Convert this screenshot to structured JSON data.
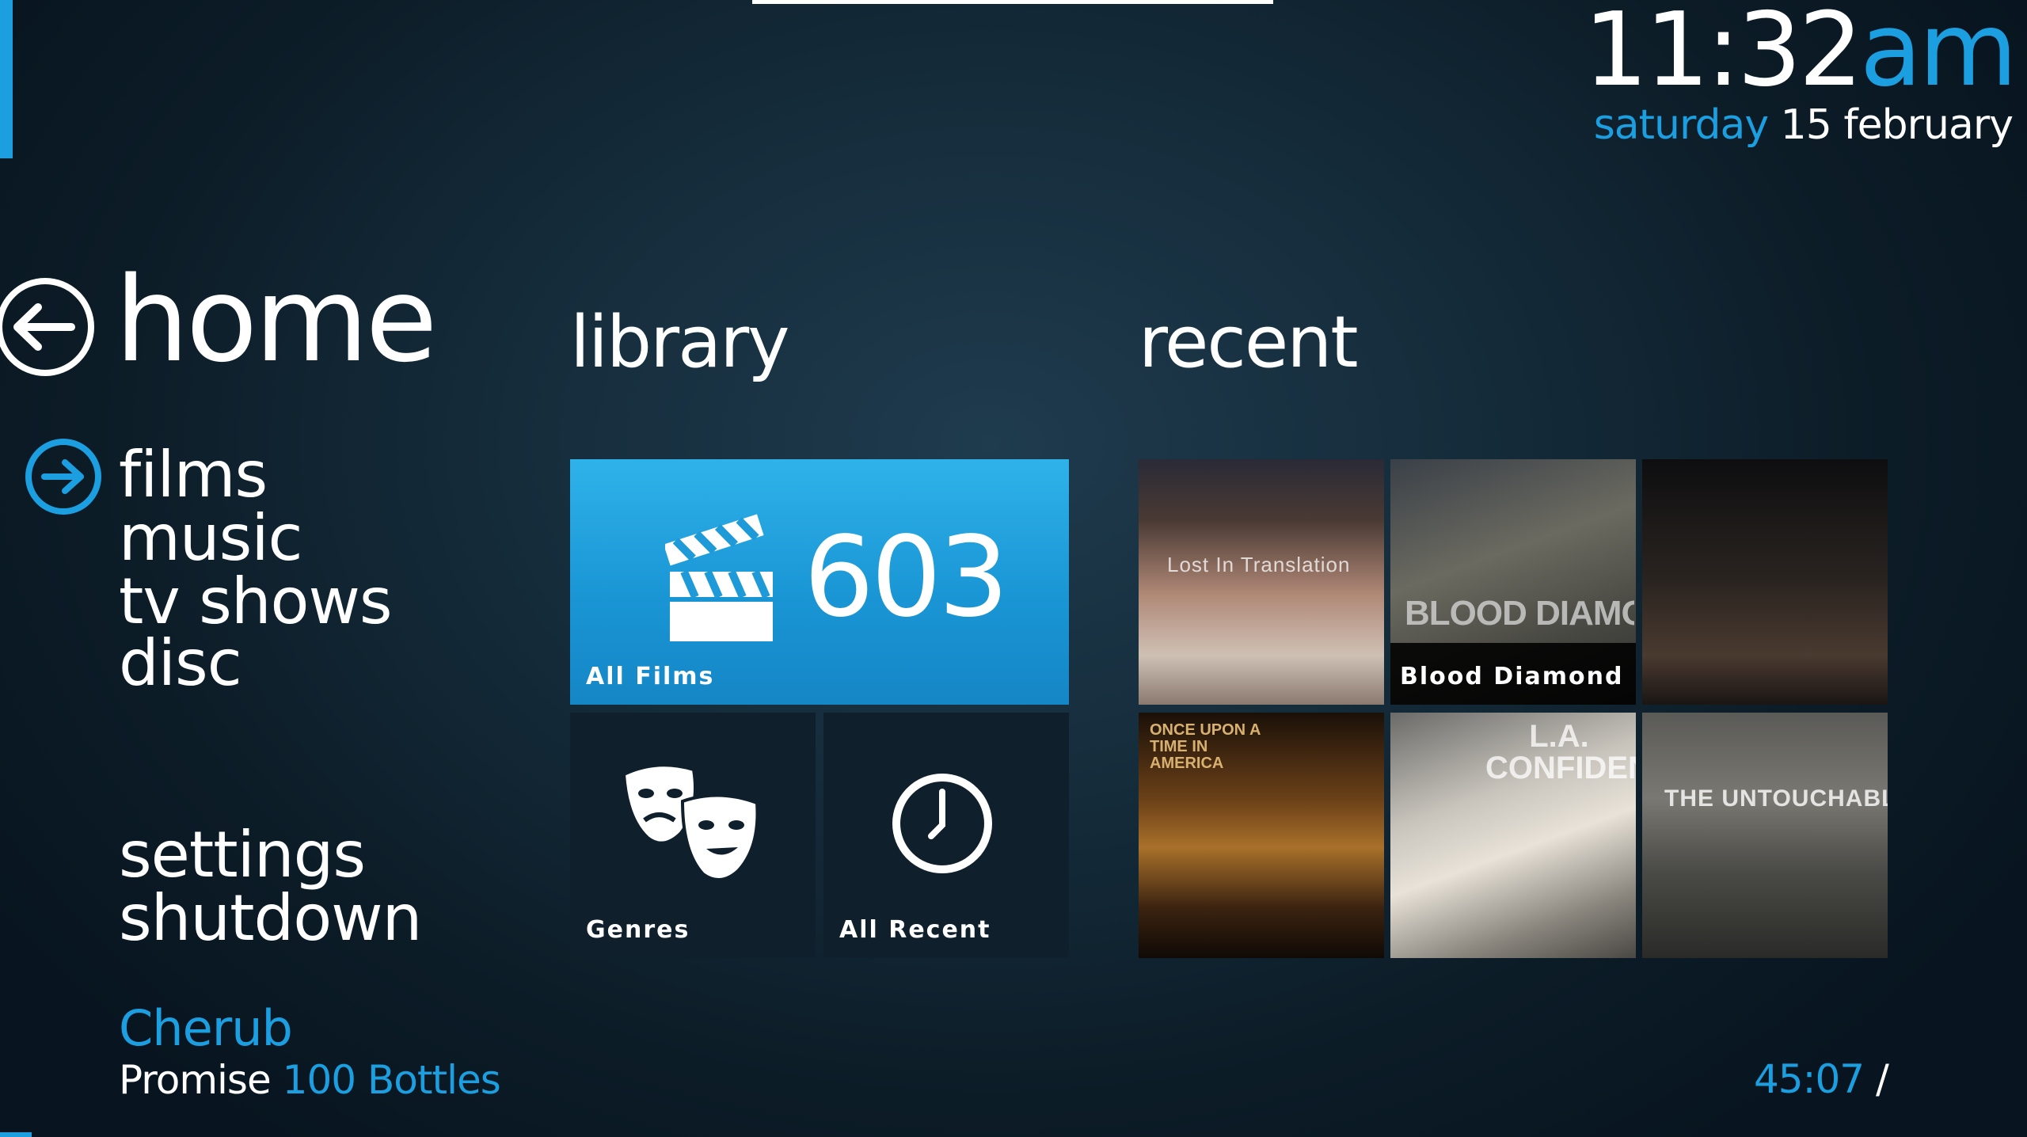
{
  "clock": {
    "time": "11:32",
    "ampm": "am"
  },
  "date": {
    "day": "saturday",
    "rest": "15 february"
  },
  "header": {
    "title": "home"
  },
  "nav": {
    "items": [
      {
        "label": "films"
      },
      {
        "label": "music"
      },
      {
        "label": "tv shows"
      },
      {
        "label": "disc"
      }
    ],
    "settings": "settings",
    "shutdown": "shutdown"
  },
  "library": {
    "heading": "library",
    "all_films": {
      "label": "All Films",
      "count": "603"
    },
    "genres": {
      "label": "Genres"
    },
    "all_recent": {
      "label": "All Recent"
    }
  },
  "recent": {
    "heading": "recent",
    "posters": [
      {
        "title": "Lost In Translation"
      },
      {
        "title": "Blood Diamond",
        "poster_text": "BLOOD DIAMOND"
      },
      {
        "title": ""
      },
      {
        "title": "",
        "poster_text": "ONCE UPON A TIME IN AMERICA"
      },
      {
        "title": "",
        "poster_text": "L.A. CONFIDENTIAL"
      },
      {
        "title": "",
        "poster_text": "THE UNTOUCHABLES"
      }
    ]
  },
  "now_playing": {
    "title": "Cherub",
    "artist": "Promise",
    "album": "100 Bottles",
    "elapsed": "45:07",
    "separator": "/"
  },
  "colors": {
    "accent": "#1b9fe0",
    "tile_blue": "#1a96d5",
    "background": "#0f2330"
  }
}
